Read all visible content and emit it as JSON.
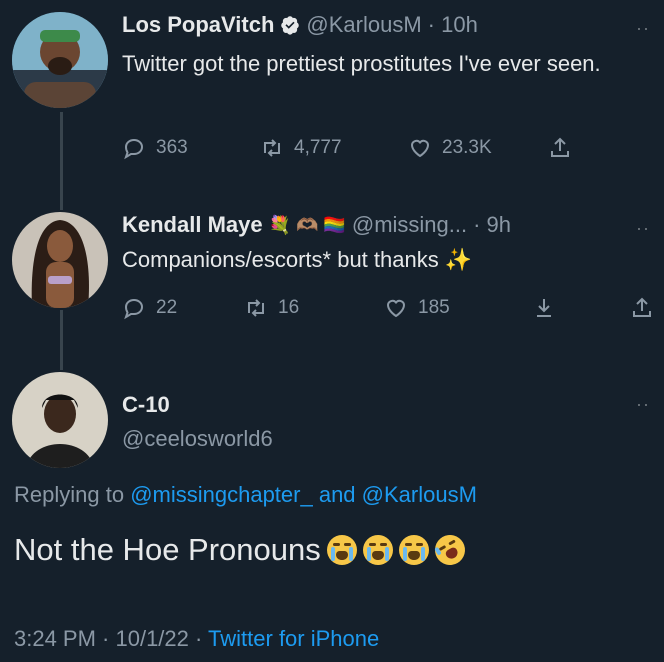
{
  "tweet1": {
    "name": "Los PopaVitch",
    "handle": "@KarlousM",
    "time": "· 10h",
    "text": "Twitter got the prettiest prostitutes I've ever seen.",
    "replies": "363",
    "retweets": "4,777",
    "likes": "23.3K",
    "more": "··"
  },
  "tweet2": {
    "name": "Kendall Maye",
    "name_emojis": "💐 🫶🏽 🏳️‍🌈",
    "handle": "@missing...",
    "time": "· 9h",
    "text": "Companions/escorts* but thanks ✨",
    "replies": "22",
    "retweets": "16",
    "likes": "185",
    "more": "··"
  },
  "main_tweet": {
    "name": "C-10",
    "handle": "@ceelosworld6",
    "replying_prefix": "Replying to ",
    "reply_handle_1": "@missingchapter_",
    "reply_and": " and ",
    "reply_handle_2": "@KarlousM",
    "text": "Not the Hoe Pronouns",
    "time": "3:24 PM · 10/1/22 ·",
    "source": "Twitter for iPhone",
    "more": "··"
  },
  "colors": {
    "background": "#15202b",
    "accent": "#1d9bf0",
    "muted": "#8b98a5",
    "verified": "#e7e9ea"
  },
  "icons": {
    "reply": "reply-icon",
    "retweet": "retweet-icon",
    "like": "heart-icon",
    "share": "share-icon",
    "download": "download-icon",
    "verified": "verified-badge-icon"
  }
}
